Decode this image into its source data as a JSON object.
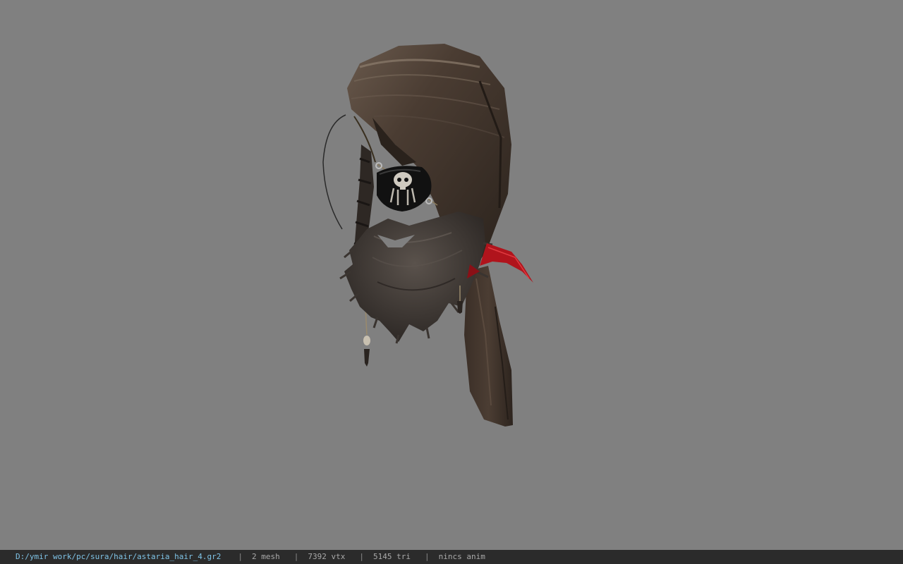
{
  "viewport": {
    "background_color": "#808080",
    "model": {
      "name_icon": "hair-mesh-model",
      "hair_color": "#3a2f27",
      "hair_highlight": "#8a7a6c",
      "beard_color": "#3d3834",
      "ribbon_color": "#b0141c",
      "eyepatch_color": "#111111"
    }
  },
  "status_bar": {
    "file_path": "D:/ymir work/pc/sura/hair/astaria_hair_4.gr2",
    "separator": "|",
    "mesh_count": "2 mesh",
    "vertex_count": "7392 vtx",
    "triangle_count": "5145 tri",
    "anim_status": "nincs anim",
    "path_color": "#7fc3e6",
    "text_color": "#a9a9a9",
    "background_color": "#2b2b2b"
  }
}
